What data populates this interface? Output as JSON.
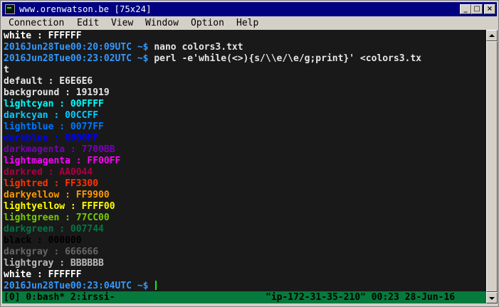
{
  "window": {
    "title": "www.orenwatson.be [75x24]",
    "minimize_glyph": "_",
    "maximize_glyph": "□",
    "close_glyph": "×"
  },
  "menu": [
    "Connection",
    "Edit",
    "View",
    "Window",
    "Option",
    "Help"
  ],
  "terminal": {
    "lines": [
      {
        "text": "white : FFFFFF",
        "color": "#ffffff"
      },
      {
        "text": "2016Jun28Tue00:20:09UTC ~$ nano colors3.txt",
        "prompt": "2016Jun28Tue00:20:09UTC ~$ ",
        "prompt_color": "#3399ff",
        "command": "nano colors3.txt",
        "color": "#e6e6e6"
      },
      {
        "text": "2016Jun28Tue00:23:02UTC ~$ perl -e'while(<>){s/\\\\e/\\e/g;print}' <colors3.tx",
        "prompt": "2016Jun28Tue00:23:02UTC ~$ ",
        "prompt_color": "#3399ff",
        "command": "perl -e'while(<>){s/\\\\e/\\e/g;print}' <colors3.tx",
        "color": "#e6e6e6"
      },
      {
        "text": "t",
        "color": "#e6e6e6"
      },
      {
        "text": "default : E6E6E6",
        "color": "#e6e6e6"
      },
      {
        "text": "background : 191919",
        "color": "#e6e6e6"
      },
      {
        "text": "lightcyan : 00FFFF",
        "color": "#00ffff"
      },
      {
        "text": "darkcyan : 00CCFF",
        "color": "#00ccff"
      },
      {
        "text": "lightblue : 0077FF",
        "color": "#0077ff"
      },
      {
        "text": "darkblue : 0000FF",
        "color": "#0000ff"
      },
      {
        "text": "darkmagenta : 7700BB",
        "color": "#7700bb"
      },
      {
        "text": "lightmagenta : FF00FF",
        "color": "#ff00ff"
      },
      {
        "text": "darkred : AA0044",
        "color": "#aa0044"
      },
      {
        "text": "lightred : FF3300",
        "color": "#ff3300"
      },
      {
        "text": "darkyellow : FF9900",
        "color": "#ff9900"
      },
      {
        "text": "lightyellow : FFFF00",
        "color": "#ffff00"
      },
      {
        "text": "lightgreen : 77CC00",
        "color": "#77cc00"
      },
      {
        "text": "darkgreen : 007744",
        "color": "#007744"
      },
      {
        "text": "black : 000000",
        "color": "#000000"
      },
      {
        "text": "darkgray : 666666",
        "color": "#666666"
      },
      {
        "text": "lightgray : BBBBBB",
        "color": "#bbbbbb"
      },
      {
        "text": "white : FFFFFF",
        "color": "#ffffff"
      },
      {
        "text": "2016Jun28Tue00:23:04UTC ~$ ",
        "prompt": "2016Jun28Tue00:23:04UTC ~$ ",
        "prompt_color": "#3399ff",
        "command": "",
        "color": "#e6e6e6",
        "cursor": true
      }
    ],
    "status": {
      "left": "[0] 0:bash* 2:irssi-",
      "right": "\"ip-172-31-35-210\" 00:23 28-Jun-16",
      "background": "#067a3d"
    }
  }
}
